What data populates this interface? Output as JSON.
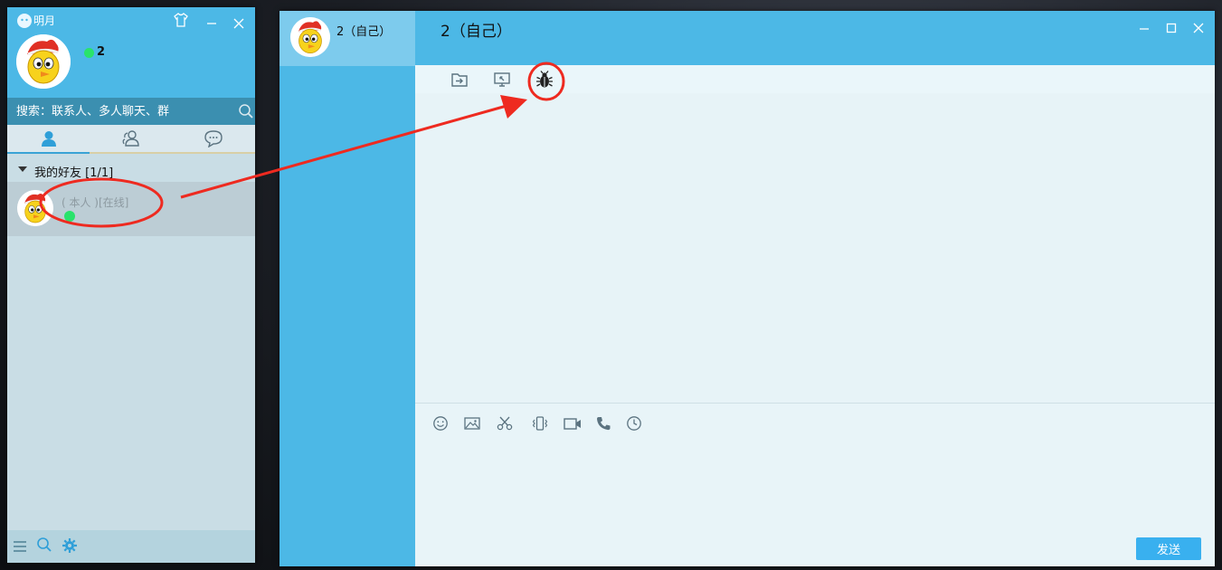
{
  "main_window": {
    "title": "明月",
    "nickname": "2",
    "search": {
      "placeholder": "搜索：联系人、多人聊天、群"
    },
    "tabs": [
      {
        "name": "contacts",
        "icon": "person-icon"
      },
      {
        "name": "groups",
        "icon": "group-icon"
      },
      {
        "name": "recent-chats",
        "icon": "chat-bubble-icon"
      }
    ],
    "group": {
      "label": "我的好友 [1/1]"
    },
    "friend": {
      "name": "( 本人 )[在线]",
      "status": "online"
    },
    "bottom_icons": [
      "menu-icon",
      "search-icon",
      "settings-icon"
    ]
  },
  "chat_window": {
    "session_name": "2（自己）",
    "title": "2（自己）",
    "top_toolbar_icons": [
      "send-file-icon",
      "remote-desktop-icon",
      "bug-icon"
    ],
    "bottom_toolbar_icons": [
      "emoji-icon",
      "image-icon",
      "screenshot-scissors-icon",
      "vibrate-icon",
      "video-call-icon",
      "voice-call-icon",
      "history-clock-icon"
    ],
    "send_label": "发送"
  },
  "colors": {
    "header_blue": "#4cb8e6",
    "search_bar": "#3b8fb0",
    "online_green": "#29e36b",
    "annotation_red": "#ee2a20",
    "send_button": "#39b0ef"
  }
}
